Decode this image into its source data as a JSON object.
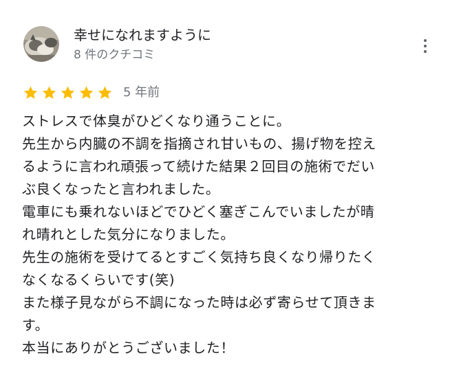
{
  "review": {
    "author_name": "幸せになれますように",
    "review_count": "8 件のクチコミ",
    "rating": 5,
    "rating_max": 5,
    "time_ago": "5 年前",
    "star_color": "#fbbc04",
    "text_lines": [
      "ストレスで体臭がひどくなり通うことに。",
      "先生から内臓の不調を指摘され甘いもの、揚げ物を控え",
      "るように言われ頑張って続けた結果２回目の施術でだい",
      "ぶ良くなったと言われました。",
      "電車にも乗れないほどでひどく塞ぎこんでいましたが晴",
      "れ晴れとした気分になりました。",
      "先生の施術を受けてるとすごく気持ち良くなり帰りたく",
      "なくなるくらいです(笑)",
      "また様子見ながら不調になった時は必ず寄らせて頂きま",
      "す。",
      "本当にありがとうございました！"
    ]
  },
  "icons": {
    "avatar": "cat-photo-avatar",
    "menu": "more-vert-icon",
    "star": "star-icon"
  }
}
